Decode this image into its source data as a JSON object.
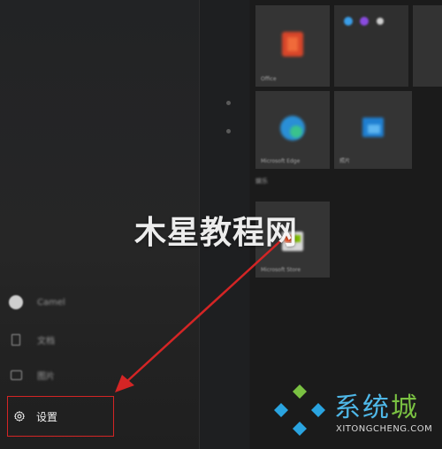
{
  "start_menu": {
    "left_items": [
      {
        "label": "Camel",
        "icon": "user-avatar-icon"
      },
      {
        "label": "文档",
        "icon": "document-icon"
      },
      {
        "label": "图片",
        "icon": "picture-icon"
      }
    ],
    "settings": {
      "label": "设置",
      "icon": "gear-icon",
      "highlight_color": "#d42525"
    }
  },
  "tiles": {
    "office_label": "Office",
    "edge_label": "Microsoft Edge",
    "photos_label": "照片",
    "group_label": "娱乐",
    "store_label": "Microsoft Store"
  },
  "annotation": {
    "arrow_color": "#d42525"
  },
  "watermarks": {
    "center_text": "木星教程网",
    "brand_cn_part1": "系统",
    "brand_cn_part2": "城",
    "brand_url": "XITONGCHENG.COM"
  }
}
